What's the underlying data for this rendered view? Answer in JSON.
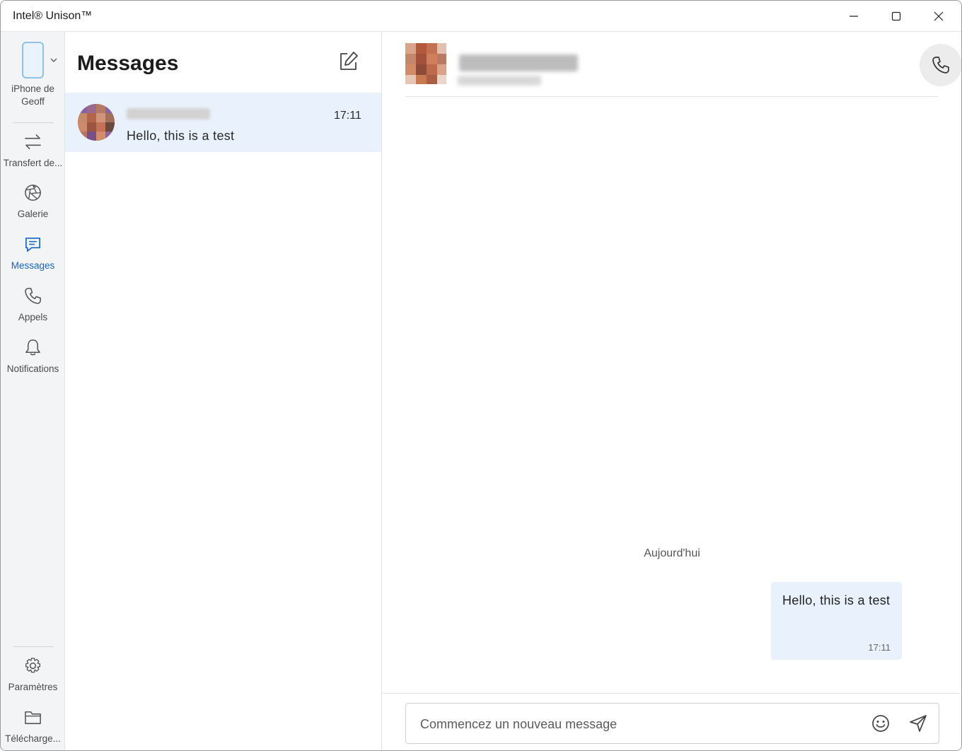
{
  "window": {
    "title": "Intel® Unison™"
  },
  "device": {
    "name": "iPhone de Geoff"
  },
  "nav": {
    "items": [
      {
        "label": "Transfert de...",
        "icon": "transfer-arrows-icon"
      },
      {
        "label": "Galerie",
        "icon": "aperture-icon"
      },
      {
        "label": "Messages",
        "icon": "message-icon",
        "active": true
      },
      {
        "label": "Appels",
        "icon": "phone-icon"
      },
      {
        "label": "Notifications",
        "icon": "bell-icon"
      }
    ],
    "bottom": [
      {
        "label": "Paramètres",
        "icon": "gear-icon"
      },
      {
        "label": "Télécharge...",
        "icon": "folder-icon"
      }
    ]
  },
  "list": {
    "title": "Messages",
    "conversations": [
      {
        "time": "17:11",
        "preview": "Hello, this is a test"
      }
    ]
  },
  "chat": {
    "day_label": "Aujourd'hui",
    "messages": [
      {
        "text": "Hello, this is a test",
        "time": "17:11",
        "direction": "outgoing"
      }
    ],
    "composer_placeholder": "Commencez un nouveau message"
  },
  "colors": {
    "accent": "#1565c0",
    "selected_bg": "#e9f2fc",
    "rail_bg": "#f3f4f6"
  }
}
